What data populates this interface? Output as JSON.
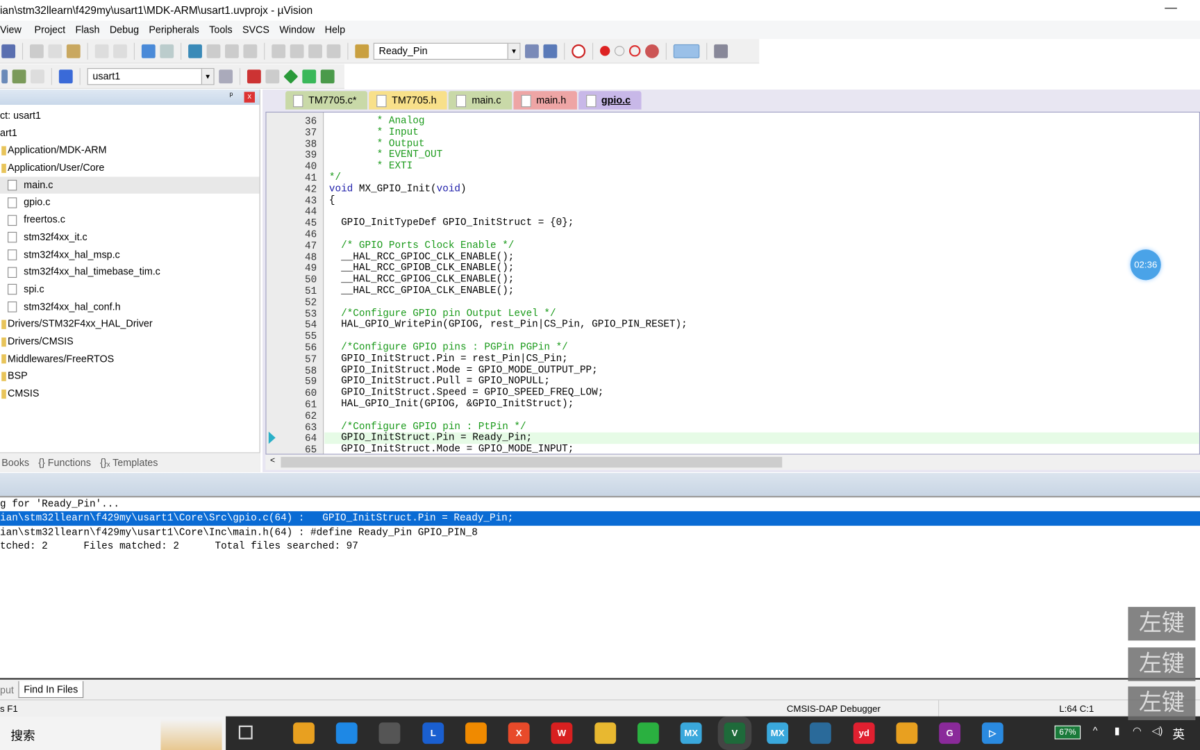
{
  "window": {
    "title": "ian\\stm32llearn\\f429my\\usart1\\MDK-ARM\\usart1.uvprojx - µVision",
    "minimize": "—"
  },
  "menu": [
    "View",
    "Project",
    "Flash",
    "Debug",
    "Peripherals",
    "Tools",
    "SVCS",
    "Window",
    "Help"
  ],
  "toolbar": {
    "find_combo": "Ready_Pin",
    "target_combo": "usart1"
  },
  "project": {
    "header_pin": "ᵖ",
    "header_close": "x",
    "items": [
      {
        "type": "root",
        "label": "ct: usart1"
      },
      {
        "type": "root",
        "label": "art1"
      },
      {
        "type": "folder",
        "label": "Application/MDK-ARM"
      },
      {
        "type": "folder",
        "label": "Application/User/Core"
      },
      {
        "type": "file",
        "label": "main.c",
        "selected": true
      },
      {
        "type": "file",
        "label": "gpio.c"
      },
      {
        "type": "file",
        "label": "freertos.c"
      },
      {
        "type": "file",
        "label": "stm32f4xx_it.c"
      },
      {
        "type": "file",
        "label": "stm32f4xx_hal_msp.c"
      },
      {
        "type": "file",
        "label": "stm32f4xx_hal_timebase_tim.c"
      },
      {
        "type": "file",
        "label": "spi.c"
      },
      {
        "type": "file",
        "label": "stm32f4xx_hal_conf.h"
      },
      {
        "type": "folder",
        "label": "Drivers/STM32F4xx_HAL_Driver"
      },
      {
        "type": "folder",
        "label": "Drivers/CMSIS"
      },
      {
        "type": "folder",
        "label": "Middlewares/FreeRTOS"
      },
      {
        "type": "folder",
        "label": "BSP"
      },
      {
        "type": "folder",
        "label": "CMSIS"
      }
    ],
    "tabs": [
      "Books",
      "{} Functions",
      "{}ₓ Templates"
    ]
  },
  "editor": {
    "tabs": [
      {
        "label": "TM7705.c*",
        "color": "#c9d9a8"
      },
      {
        "label": "TM7705.h",
        "color": "#f8e08a"
      },
      {
        "label": "main.c",
        "color": "#c9d9a8"
      },
      {
        "label": "main.h",
        "color": "#eea5a5"
      },
      {
        "label": "gpio.c",
        "color": "#c8b8e8",
        "active": true
      }
    ],
    "current_line": 64,
    "lines": [
      {
        "n": "36",
        "t": "        * Analog",
        "c": "cmt"
      },
      {
        "n": "37",
        "t": "        * Input",
        "c": "cmt"
      },
      {
        "n": "38",
        "t": "        * Output",
        "c": "cmt"
      },
      {
        "n": "39",
        "t": "        * EVENT_OUT",
        "c": "cmt"
      },
      {
        "n": "40",
        "t": "        * EXTI",
        "c": "cmt"
      },
      {
        "n": "41",
        "t": "*/",
        "c": "cmt"
      },
      {
        "n": "42",
        "t": "void MX_GPIO_Init(void)",
        "c": ""
      },
      {
        "n": "43",
        "t": "{",
        "c": ""
      },
      {
        "n": "44",
        "t": "",
        "c": ""
      },
      {
        "n": "45",
        "t": "  GPIO_InitTypeDef GPIO_InitStruct = {0};",
        "c": ""
      },
      {
        "n": "46",
        "t": "",
        "c": ""
      },
      {
        "n": "47",
        "t": "  /* GPIO Ports Clock Enable */",
        "c": "cmt"
      },
      {
        "n": "48",
        "t": "  __HAL_RCC_GPIOC_CLK_ENABLE();",
        "c": ""
      },
      {
        "n": "49",
        "t": "  __HAL_RCC_GPIOB_CLK_ENABLE();",
        "c": ""
      },
      {
        "n": "50",
        "t": "  __HAL_RCC_GPIOG_CLK_ENABLE();",
        "c": ""
      },
      {
        "n": "51",
        "t": "  __HAL_RCC_GPIOA_CLK_ENABLE();",
        "c": ""
      },
      {
        "n": "52",
        "t": "",
        "c": ""
      },
      {
        "n": "53",
        "t": "  /*Configure GPIO pin Output Level */",
        "c": "cmt"
      },
      {
        "n": "54",
        "t": "  HAL_GPIO_WritePin(GPIOG, rest_Pin|CS_Pin, GPIO_PIN_RESET);",
        "c": ""
      },
      {
        "n": "55",
        "t": "",
        "c": ""
      },
      {
        "n": "56",
        "t": "  /*Configure GPIO pins : PGPin PGPin */",
        "c": "cmt"
      },
      {
        "n": "57",
        "t": "  GPIO_InitStruct.Pin = rest_Pin|CS_Pin;",
        "c": ""
      },
      {
        "n": "58",
        "t": "  GPIO_InitStruct.Mode = GPIO_MODE_OUTPUT_PP;",
        "c": ""
      },
      {
        "n": "59",
        "t": "  GPIO_InitStruct.Pull = GPIO_NOPULL;",
        "c": ""
      },
      {
        "n": "60",
        "t": "  GPIO_InitStruct.Speed = GPIO_SPEED_FREQ_LOW;",
        "c": ""
      },
      {
        "n": "61",
        "t": "  HAL_GPIO_Init(GPIOG, &GPIO_InitStruct);",
        "c": ""
      },
      {
        "n": "62",
        "t": "",
        "c": ""
      },
      {
        "n": "63",
        "t": "  /*Configure GPIO pin : PtPin */",
        "c": "cmt"
      },
      {
        "n": "64",
        "t": "  GPIO_InitStruct.Pin = Ready_Pin;",
        "c": ""
      },
      {
        "n": "65",
        "t": "  GPIO_InitStruct.Mode = GPIO_MODE_INPUT;",
        "c": ""
      }
    ]
  },
  "output": {
    "lines": [
      "g for 'Ready_Pin'...",
      "ian\\stm32llearn\\f429my\\usart1\\Core\\Src\\gpio.c(64) :   GPIO_InitStruct.Pin = Ready_Pin;",
      "ian\\stm32llearn\\f429my\\usart1\\Core\\Inc\\main.h(64) : #define Ready_Pin GPIO_PIN_8",
      "tched: 2      Files matched: 2      Total files searched: 97"
    ],
    "selected": 1,
    "tabs": [
      "put",
      "Find In Files"
    ]
  },
  "status": {
    "left": "s F1",
    "debugger": "CMSIS-DAP Debugger",
    "position": "L:64 C:1"
  },
  "overlay": {
    "timer": "02:36",
    "key_hint": "左键"
  },
  "taskbar": {
    "search": "搜索",
    "battery": "67%",
    "ime": "英",
    "apps": [
      {
        "label": "",
        "color": "#e8a020"
      },
      {
        "label": "",
        "color": "#1e88e5"
      },
      {
        "label": "",
        "color": "#555"
      },
      {
        "label": "L",
        "color": "#1a5fd0"
      },
      {
        "label": "",
        "color": "#f08a00"
      },
      {
        "label": "X",
        "color": "#e84a2a"
      },
      {
        "label": "W",
        "color": "#d82020"
      },
      {
        "label": "",
        "color": "#e8b830"
      },
      {
        "label": "",
        "color": "#2ab040"
      },
      {
        "label": "MX",
        "color": "#3aa8dc"
      },
      {
        "label": "V",
        "color": "#1e6a3a"
      },
      {
        "label": "MX",
        "color": "#3aa8dc"
      },
      {
        "label": "",
        "color": "#2a6a9a"
      },
      {
        "label": "yd",
        "color": "#e02030"
      },
      {
        "label": "",
        "color": "#e8a020"
      },
      {
        "label": "G",
        "color": "#8a2a9a"
      },
      {
        "label": "▷",
        "color": "#2a8ae0"
      }
    ]
  }
}
